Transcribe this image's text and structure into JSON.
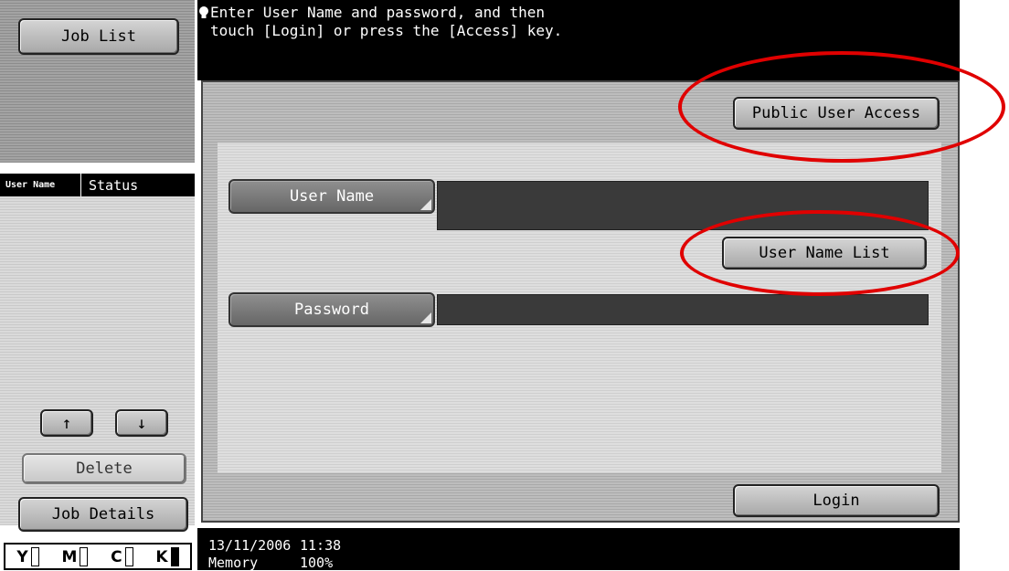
{
  "sidebar": {
    "job_list_label": "Job List",
    "columns": {
      "user_name": "User Name",
      "status": "Status"
    },
    "up_arrow": "↑",
    "down_arrow": "↓",
    "delete_label": "Delete",
    "job_details_label": "Job Details"
  },
  "message": {
    "line1": "Enter User Name and password, and then",
    "line2": "touch [Login] or press the [Access] key."
  },
  "login": {
    "public_user_access_label": "Public User Access",
    "user_name_label": "User Name",
    "user_name_value": "",
    "user_name_list_label": "User Name List",
    "password_label": "Password",
    "password_value": "",
    "login_label": "Login"
  },
  "status": {
    "date": "13/11/2006",
    "time": "11:38",
    "memory_label": "Memory",
    "memory_value": "100%"
  },
  "toner": {
    "y": "Y",
    "m": "M",
    "c": "C",
    "k": "K"
  },
  "colors": {
    "annotation": "#e00000",
    "background_dark": "#000000"
  }
}
